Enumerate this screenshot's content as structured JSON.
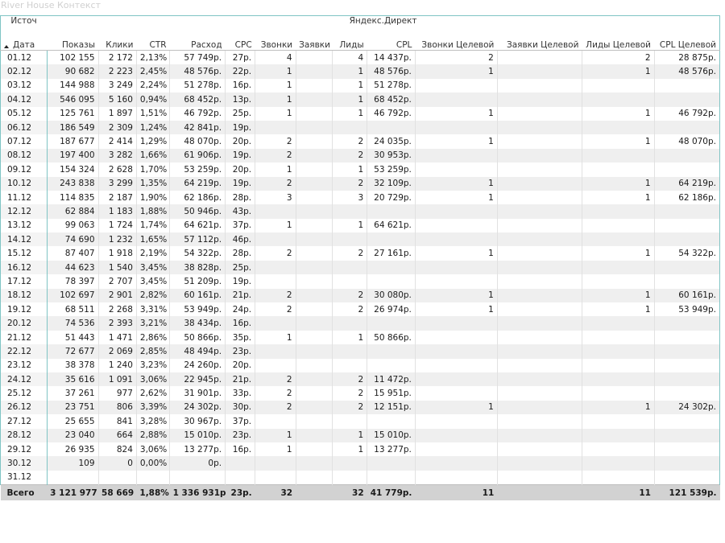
{
  "title": "River House Контекст",
  "header": {
    "source_label": "Источ",
    "group_label": "Яндекс.Директ",
    "date_label": "Дата",
    "columns": [
      "Показы",
      "Клики",
      "CTR",
      "Расход",
      "CPC",
      "Звонки",
      "Заявки",
      "Лиды",
      "CPL",
      "Звонки Целевой",
      "Заявки Целевой",
      "Лиды Целевой",
      "CPL Целевой"
    ]
  },
  "rows": [
    [
      "01.12",
      "102 155",
      "2 172",
      "2,13%",
      "57 749р.",
      "27р.",
      "4",
      "",
      "4",
      "14 437р.",
      "2",
      "",
      "2",
      "28 875р."
    ],
    [
      "02.12",
      "90 682",
      "2 223",
      "2,45%",
      "48 576р.",
      "22р.",
      "1",
      "",
      "1",
      "48 576р.",
      "1",
      "",
      "1",
      "48 576р."
    ],
    [
      "03.12",
      "144 988",
      "3 249",
      "2,24%",
      "51 278р.",
      "16р.",
      "1",
      "",
      "1",
      "51 278р.",
      "",
      "",
      "",
      ""
    ],
    [
      "04.12",
      "546 095",
      "5 160",
      "0,94%",
      "68 452р.",
      "13р.",
      "1",
      "",
      "1",
      "68 452р.",
      "",
      "",
      "",
      ""
    ],
    [
      "05.12",
      "125 761",
      "1 897",
      "1,51%",
      "46 792р.",
      "25р.",
      "1",
      "",
      "1",
      "46 792р.",
      "1",
      "",
      "1",
      "46 792р."
    ],
    [
      "06.12",
      "186 549",
      "2 309",
      "1,24%",
      "42 841р.",
      "19р.",
      "",
      "",
      "",
      "",
      "",
      "",
      "",
      ""
    ],
    [
      "07.12",
      "187 677",
      "2 414",
      "1,29%",
      "48 070р.",
      "20р.",
      "2",
      "",
      "2",
      "24 035р.",
      "1",
      "",
      "1",
      "48 070р."
    ],
    [
      "08.12",
      "197 400",
      "3 282",
      "1,66%",
      "61 906р.",
      "19р.",
      "2",
      "",
      "2",
      "30 953р.",
      "",
      "",
      "",
      ""
    ],
    [
      "09.12",
      "154 324",
      "2 628",
      "1,70%",
      "53 259р.",
      "20р.",
      "1",
      "",
      "1",
      "53 259р.",
      "",
      "",
      "",
      ""
    ],
    [
      "10.12",
      "243 838",
      "3 299",
      "1,35%",
      "64 219р.",
      "19р.",
      "2",
      "",
      "2",
      "32 109р.",
      "1",
      "",
      "1",
      "64 219р."
    ],
    [
      "11.12",
      "114 835",
      "2 187",
      "1,90%",
      "62 186р.",
      "28р.",
      "3",
      "",
      "3",
      "20 729р.",
      "1",
      "",
      "1",
      "62 186р."
    ],
    [
      "12.12",
      "62 884",
      "1 183",
      "1,88%",
      "50 946р.",
      "43р.",
      "",
      "",
      "",
      "",
      "",
      "",
      "",
      ""
    ],
    [
      "13.12",
      "99 063",
      "1 724",
      "1,74%",
      "64 621р.",
      "37р.",
      "1",
      "",
      "1",
      "64 621р.",
      "",
      "",
      "",
      ""
    ],
    [
      "14.12",
      "74 690",
      "1 232",
      "1,65%",
      "57 112р.",
      "46р.",
      "",
      "",
      "",
      "",
      "",
      "",
      "",
      ""
    ],
    [
      "15.12",
      "87 407",
      "1 918",
      "2,19%",
      "54 322р.",
      "28р.",
      "2",
      "",
      "2",
      "27 161р.",
      "1",
      "",
      "1",
      "54 322р."
    ],
    [
      "16.12",
      "44 623",
      "1 540",
      "3,45%",
      "38 828р.",
      "25р.",
      "",
      "",
      "",
      "",
      "",
      "",
      "",
      ""
    ],
    [
      "17.12",
      "78 397",
      "2 707",
      "3,45%",
      "51 209р.",
      "19р.",
      "",
      "",
      "",
      "",
      "",
      "",
      "",
      ""
    ],
    [
      "18.12",
      "102 697",
      "2 901",
      "2,82%",
      "60 161р.",
      "21р.",
      "2",
      "",
      "2",
      "30 080р.",
      "1",
      "",
      "1",
      "60 161р."
    ],
    [
      "19.12",
      "68 511",
      "2 268",
      "3,31%",
      "53 949р.",
      "24р.",
      "2",
      "",
      "2",
      "26 974р.",
      "1",
      "",
      "1",
      "53 949р."
    ],
    [
      "20.12",
      "74 536",
      "2 393",
      "3,21%",
      "38 434р.",
      "16р.",
      "",
      "",
      "",
      "",
      "",
      "",
      "",
      ""
    ],
    [
      "21.12",
      "51 443",
      "1 471",
      "2,86%",
      "50 866р.",
      "35р.",
      "1",
      "",
      "1",
      "50 866р.",
      "",
      "",
      "",
      ""
    ],
    [
      "22.12",
      "72 677",
      "2 069",
      "2,85%",
      "48 494р.",
      "23р.",
      "",
      "",
      "",
      "",
      "",
      "",
      "",
      ""
    ],
    [
      "23.12",
      "38 378",
      "1 240",
      "3,23%",
      "24 260р.",
      "20р.",
      "",
      "",
      "",
      "",
      "",
      "",
      "",
      ""
    ],
    [
      "24.12",
      "35 616",
      "1 091",
      "3,06%",
      "22 945р.",
      "21р.",
      "2",
      "",
      "2",
      "11 472р.",
      "",
      "",
      "",
      ""
    ],
    [
      "25.12",
      "37 261",
      "977",
      "2,62%",
      "31 901р.",
      "33р.",
      "2",
      "",
      "2",
      "15 951р.",
      "",
      "",
      "",
      ""
    ],
    [
      "26.12",
      "23 751",
      "806",
      "3,39%",
      "24 302р.",
      "30р.",
      "2",
      "",
      "2",
      "12 151р.",
      "1",
      "",
      "1",
      "24 302р."
    ],
    [
      "27.12",
      "25 655",
      "841",
      "3,28%",
      "30 967р.",
      "37р.",
      "",
      "",
      "",
      "",
      "",
      "",
      "",
      ""
    ],
    [
      "28.12",
      "23 040",
      "664",
      "2,88%",
      "15 010р.",
      "23р.",
      "1",
      "",
      "1",
      "15 010р.",
      "",
      "",
      "",
      ""
    ],
    [
      "29.12",
      "26 935",
      "824",
      "3,06%",
      "13 277р.",
      "16р.",
      "1",
      "",
      "1",
      "13 277р.",
      "",
      "",
      "",
      ""
    ],
    [
      "30.12",
      "109",
      "0",
      "0,00%",
      "0р.",
      "",
      "",
      "",
      "",
      "",
      "",
      "",
      "",
      ""
    ],
    [
      "31.12",
      "",
      "",
      "",
      "",
      "",
      "",
      "",
      "",
      "",
      "",
      "",
      "",
      ""
    ]
  ],
  "total": [
    "Всего",
    "3 121 977",
    "58 669",
    "1,88%",
    "1 336 931р.",
    "23р.",
    "32",
    "",
    "32",
    "41 779р.",
    "11",
    "",
    "11",
    "121 539р."
  ]
}
